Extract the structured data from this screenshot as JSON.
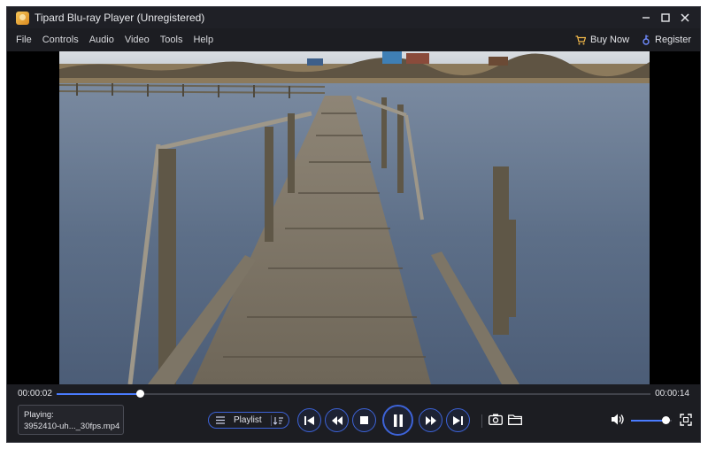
{
  "window": {
    "title": "Tipard Blu-ray Player (Unregistered)"
  },
  "titlebar": {
    "minimize": "—",
    "maximize": "☐",
    "close": "✕"
  },
  "menu": {
    "items": [
      "File",
      "Controls",
      "Audio",
      "Video",
      "Tools",
      "Help"
    ],
    "buy_now": "Buy Now",
    "register": "Register"
  },
  "player": {
    "current_time": "00:00:02",
    "duration": "00:00:14",
    "progress_fraction": 0.14,
    "volume_fraction": 0.85,
    "playing_label": "Playing:",
    "file_name": "3952410-uh..._30fps.mp4",
    "playlist_label": "Playlist",
    "state": "playing"
  },
  "colors": {
    "accent": "#3d63d8",
    "progress": "#4a7cff",
    "background": "#1c1d22"
  },
  "icons": [
    "app-logo-icon",
    "cart-icon",
    "key-icon",
    "previous-icon",
    "rewind-icon",
    "stop-icon",
    "pause-icon",
    "fast-forward-icon",
    "next-icon",
    "camera-icon",
    "folder-icon",
    "volume-icon",
    "fullscreen-icon",
    "playlist-icon",
    "sort-icon"
  ]
}
